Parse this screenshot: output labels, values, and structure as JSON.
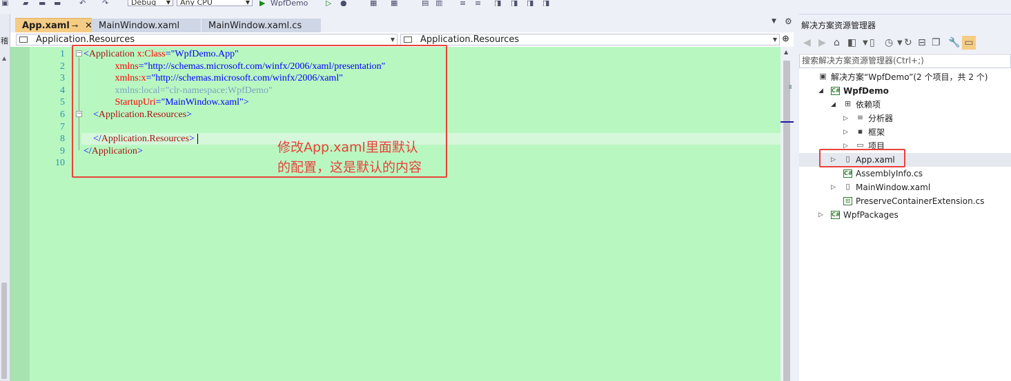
{
  "toolbar": {
    "configuration": "Debug",
    "platform": "Any CPU",
    "start_target": "WpfDemo"
  },
  "left_strip": {
    "label": "稽"
  },
  "tabs": [
    {
      "label": "App.xaml",
      "active": true
    },
    {
      "label": "MainWindow.xaml",
      "active": false
    },
    {
      "label": "MainWindow.xaml.cs",
      "active": false
    }
  ],
  "navbar": {
    "left_combo": "Application.Resources",
    "right_combo": "Application.Resources"
  },
  "editor": {
    "line_numbers": [
      "1",
      "2",
      "3",
      "4",
      "5",
      "6",
      "7",
      "8",
      "9",
      "10"
    ],
    "lines": [
      [
        {
          "t": "<",
          "c": "b"
        },
        {
          "t": "Application",
          "c": "m"
        },
        {
          "t": " x:Class",
          "c": "r"
        },
        {
          "t": "=",
          "c": "b"
        },
        {
          "t": "\"WpfDemo.App\"",
          "c": "v"
        }
      ],
      [
        {
          "t": "             xmlns",
          "c": "r"
        },
        {
          "t": "=",
          "c": "b"
        },
        {
          "t": "\"http://schemas.microsoft.com/winfx/2006/xaml/presentation\"",
          "c": "v"
        }
      ],
      [
        {
          "t": "             xmlns:x",
          "c": "r"
        },
        {
          "t": "=",
          "c": "b"
        },
        {
          "t": "\"http://schemas.microsoft.com/winfx/2006/xaml\"",
          "c": "v"
        }
      ],
      [
        {
          "t": "             xmlns:local",
          "c": "g"
        },
        {
          "t": "=",
          "c": "g"
        },
        {
          "t": "\"clr-namespace:WpfDemo\"",
          "c": "g"
        }
      ],
      [
        {
          "t": "             StartupUri",
          "c": "r"
        },
        {
          "t": "=",
          "c": "b"
        },
        {
          "t": "\"MainWindow.xaml\"",
          "c": "v"
        },
        {
          "t": ">",
          "c": "b"
        }
      ],
      [
        {
          "t": "    <",
          "c": "b"
        },
        {
          "t": "Application.Resources",
          "c": "m"
        },
        {
          "t": ">",
          "c": "b"
        }
      ],
      [],
      [
        {
          "t": "    </",
          "c": "b"
        },
        {
          "t": "Application.Resources",
          "c": "m"
        },
        {
          "t": ">",
          "c": "b"
        }
      ],
      [
        {
          "t": "</",
          "c": "b"
        },
        {
          "t": "Application",
          "c": "m"
        },
        {
          "t": ">",
          "c": "b"
        }
      ],
      []
    ]
  },
  "annotation": {
    "line1": "修改App.xaml里面默认",
    "line2": "的配置，这是默认的内容",
    "color": "#e8413a"
  },
  "solution_explorer": {
    "title": "解决方案资源管理器",
    "search_placeholder": "搜索解决方案资源管理器(Ctrl+;)",
    "items": [
      {
        "label": "解决方案“WpfDemo”(2 个项目，共 2 个)",
        "level": 0,
        "expander": "",
        "icon": "solution-icon",
        "bold": false
      },
      {
        "label": "WpfDemo",
        "level": 1,
        "expander": "◢",
        "icon": "csharp-project-icon",
        "bold": true
      },
      {
        "label": "依赖项",
        "level": 2,
        "expander": "◢",
        "icon": "dependencies-icon",
        "bold": false
      },
      {
        "label": "分析器",
        "level": 3,
        "expander": "▷",
        "icon": "analyzer-icon",
        "bold": false
      },
      {
        "label": "框架",
        "level": 3,
        "expander": "▷",
        "icon": "framework-icon",
        "bold": false
      },
      {
        "label": "项目",
        "level": 3,
        "expander": "▷",
        "icon": "project-ref-icon",
        "bold": false
      },
      {
        "label": "App.xaml",
        "level": 2,
        "expander": "▷",
        "icon": "xaml-file-icon",
        "bold": false
      },
      {
        "label": "AssemblyInfo.cs",
        "level": 2,
        "expander": "",
        "icon": "csharp-file-icon",
        "bold": false
      },
      {
        "label": "MainWindow.xaml",
        "level": 2,
        "expander": "▷",
        "icon": "xaml-file-icon",
        "bold": false
      },
      {
        "label": "PreserveContainerExtension.cs",
        "level": 2,
        "expander": "",
        "icon": "csharp-class-icon",
        "bold": false
      },
      {
        "label": "WpfPackages",
        "level": 1,
        "expander": "▷",
        "icon": "csharp-project-icon",
        "bold": false
      }
    ]
  }
}
